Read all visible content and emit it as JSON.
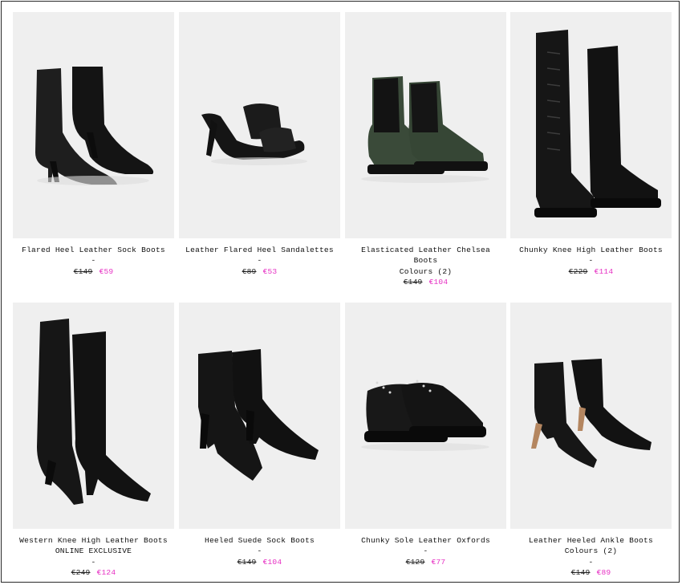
{
  "colors": {
    "sale": "#e62fc3",
    "image_bg": "#efefef",
    "border": "#2a2a2a"
  },
  "products": [
    {
      "name": "Flared Heel Leather Sock Boots",
      "dash": "-",
      "old_price": "€149",
      "new_price": "€59"
    },
    {
      "name": "Leather Flared Heel Sandalettes",
      "dash": "-",
      "old_price": "€89",
      "new_price": "€53"
    },
    {
      "name_line1": "Elasticated Leather Chelsea",
      "name_line2": "Boots",
      "colours": "Colours (2)",
      "old_price": "€149",
      "new_price": "€104"
    },
    {
      "name": "Chunky Knee High Leather Boots",
      "dash": "-",
      "old_price": "€229",
      "new_price": "€114"
    },
    {
      "name": "Western Knee High Leather Boots",
      "tag": "ONLINE EXCLUSIVE",
      "dash": "-",
      "old_price": "€249",
      "new_price": "€124"
    },
    {
      "name": "Heeled Suede Sock Boots",
      "dash": "-",
      "old_price": "€149",
      "new_price": "€104"
    },
    {
      "name": "Chunky Sole Leather Oxfords",
      "dash": "-",
      "old_price": "€129",
      "new_price": "€77"
    },
    {
      "name": "Leather Heeled Ankle Boots",
      "colours": "Colours (2)",
      "dash": "-",
      "old_price": "€149",
      "new_price": "€89"
    }
  ],
  "images": [
    "sock-boots-photo",
    "sandalettes-photo",
    "chelsea-boots-photo",
    "knee-high-lace-boots-photo",
    "western-boots-photo",
    "suede-sock-boots-photo",
    "oxfords-photo",
    "ankle-boots-photo"
  ]
}
